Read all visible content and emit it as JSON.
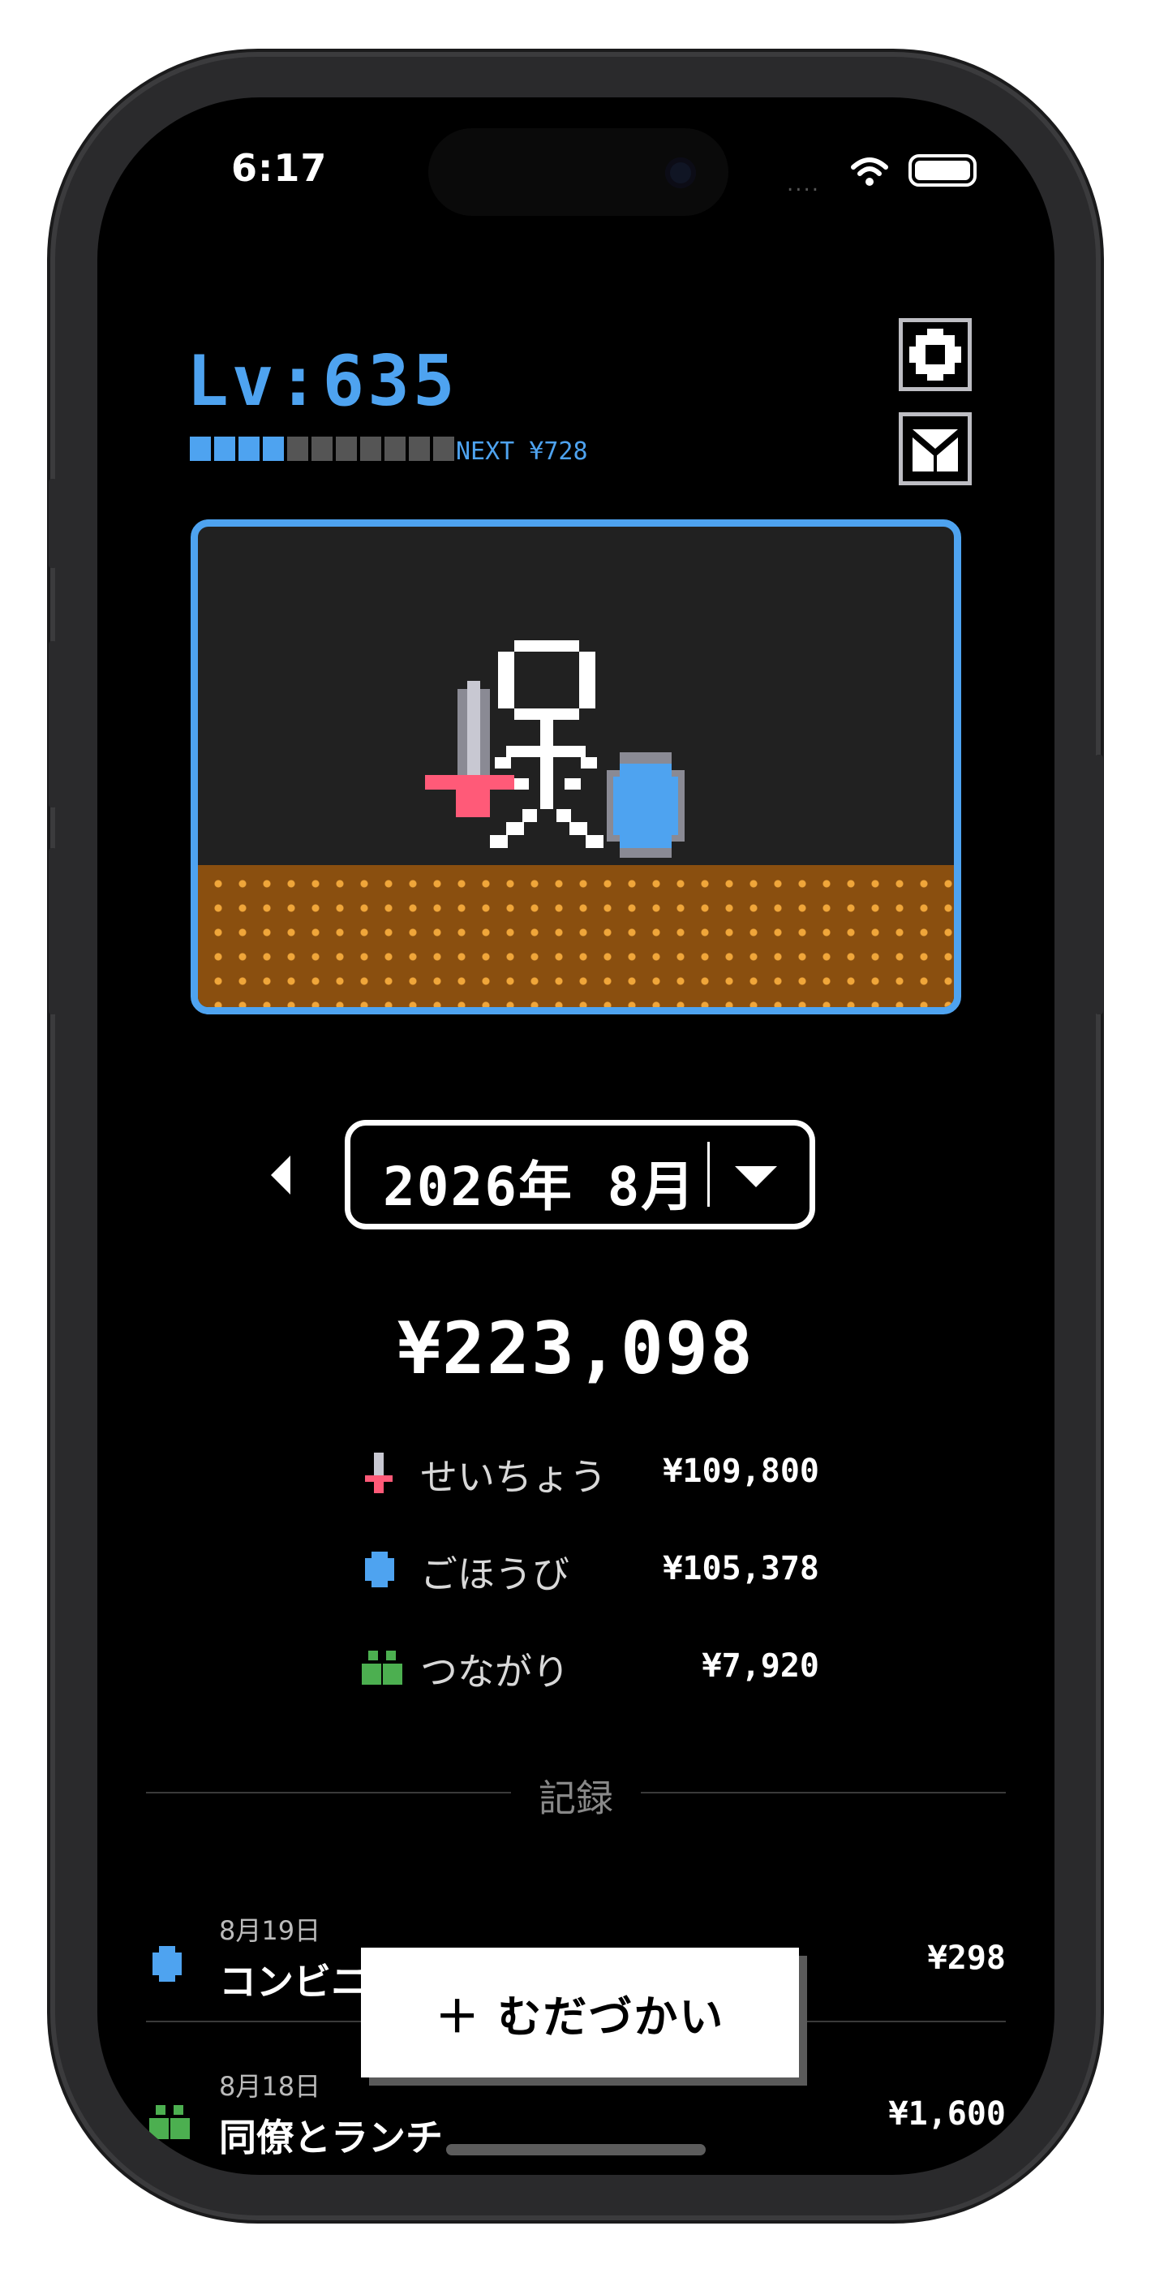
{
  "status_bar": {
    "time": "6:17",
    "signal_dots": "...."
  },
  "level": {
    "label": "Lv:635",
    "xp_filled": 4,
    "xp_total": 11,
    "next_label": "NEXT ¥728"
  },
  "month_selector": {
    "label": "2026年 8月"
  },
  "summary": {
    "total": "¥223,098",
    "categories": [
      {
        "icon": "sword-icon",
        "label": "せいちょう",
        "amount": "¥109,800"
      },
      {
        "icon": "shield-icon",
        "label": "ごほうび",
        "amount": "¥105,378"
      },
      {
        "icon": "people-icon",
        "label": "つながり",
        "amount": "¥7,920"
      }
    ]
  },
  "records": {
    "heading": "記録",
    "items": [
      {
        "icon": "shield-icon",
        "date": "8月19日",
        "title": "コンビニ",
        "amount": "¥298"
      },
      {
        "icon": "people-icon",
        "date": "8月18日",
        "title": "同僚とランチ",
        "amount": "¥1,600"
      }
    ]
  },
  "fab": {
    "label": "＋ むだづかい"
  },
  "colors": {
    "accent": "#4ea3f0",
    "ground": "#8a4f0f",
    "sword_guard": "#ff5a78",
    "people": "#4caf50"
  }
}
